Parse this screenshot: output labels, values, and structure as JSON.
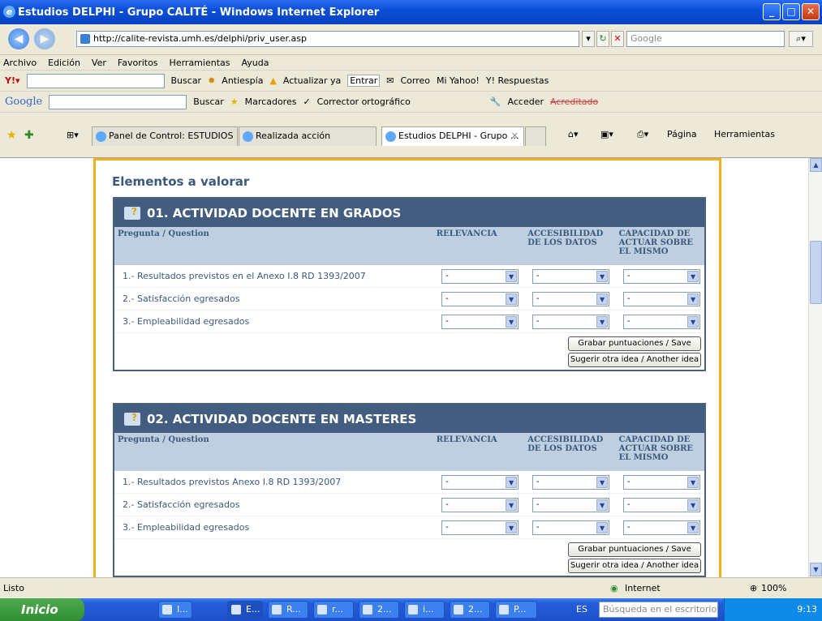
{
  "window": {
    "title": "Estudios DELPHI - Grupo CALITÉ - Windows Internet Explorer"
  },
  "address": {
    "url": "http://calite-revista.umh.es/delphi/priv_user.asp",
    "search_placeholder": "Google"
  },
  "menu": [
    "Archivo",
    "Edición",
    "Ver",
    "Favoritos",
    "Herramientas",
    "Ayuda"
  ],
  "toolbar1": {
    "buscar": "Buscar",
    "antiespia": "Antiespía",
    "actualizar": "Actualizar ya",
    "entrar": "Entrar",
    "correo": "Correo",
    "mi_yahoo": "Mi Yahoo!",
    "respuestas": "Y! Respuestas"
  },
  "toolbar2": {
    "google": "Google",
    "buscar": "Buscar",
    "marcadores": "Marcadores",
    "corrector": "Corrector ortográfico",
    "acceder": "Acceder",
    "acreditado": "Acreditado"
  },
  "tabs": [
    {
      "label": "Panel de Control: ESTUDIOS ..."
    },
    {
      "label": "Realizada acción"
    },
    {
      "label": "Estudios DELPHI - Grupo ..."
    }
  ],
  "tab_tools": {
    "pagina": "Página",
    "herramientas": "Herramientas"
  },
  "page": {
    "section_title": "Elementos a valorar",
    "panels": [
      {
        "title": "01. ACTIVIDAD DOCENTE EN GRADOS",
        "col_question": "Pregunta / Question",
        "col_relevancia": "RELEVANCIA",
        "col_accesibilidad": "ACCESIBILIDAD DE LOS DATOS",
        "col_capacidad": "CAPACIDAD DE ACTUAR SOBRE EL MISMO",
        "rows": [
          {
            "q": "1.-  Resultados previstos en el Anexo I.8 RD 1393/2007",
            "v1": "-",
            "v2": "-",
            "v3": "-"
          },
          {
            "q": "2.-  Satisfacción egresados",
            "v1": "-",
            "v2": "-",
            "v3": "-"
          },
          {
            "q": "3.-  Empleabilidad egresados",
            "v1": "-",
            "v2": "-",
            "v3": "-"
          }
        ],
        "save_label": "Grabar puntuaciones / Save",
        "idea_label": "Sugerir otra idea / Another idea"
      },
      {
        "title": "02. ACTIVIDAD DOCENTE EN MASTERES",
        "col_question": "Pregunta / Question",
        "col_relevancia": "RELEVANCIA",
        "col_accesibilidad": "ACCESIBILIDAD DE LOS DATOS",
        "col_capacidad": "CAPACIDAD DE ACTUAR SOBRE EL MISMO",
        "rows": [
          {
            "q": "1.-  Resultados previstos Anexo I.8 RD 1393/2007",
            "v1": "-",
            "v2": "-",
            "v3": "-"
          },
          {
            "q": "2.-  Satisfacción egresados",
            "v1": "-",
            "v2": "-",
            "v3": "-"
          },
          {
            "q": "3.-  Empleabilidad egresados",
            "v1": "-",
            "v2": "-",
            "v3": "-"
          }
        ],
        "save_label": "Grabar puntuaciones / Save",
        "idea_label": "Sugerir otra idea / Another idea"
      }
    ]
  },
  "status": {
    "text": "Listo",
    "zone": "Internet",
    "zoom": "100%"
  },
  "taskbar": {
    "start": "Inicio",
    "items": [
      "I...",
      "E...",
      "R...",
      "r...",
      "2...",
      "i...",
      "2...",
      "P..."
    ],
    "lang": "ES",
    "search_placeholder": "Búsqueda en el escritorio",
    "clock": "9:13"
  },
  "colors": {
    "accent": "#f2b01e",
    "panel_header": "#435d80",
    "column_header": "#bfcfe2",
    "text": "#3b5a7a"
  }
}
